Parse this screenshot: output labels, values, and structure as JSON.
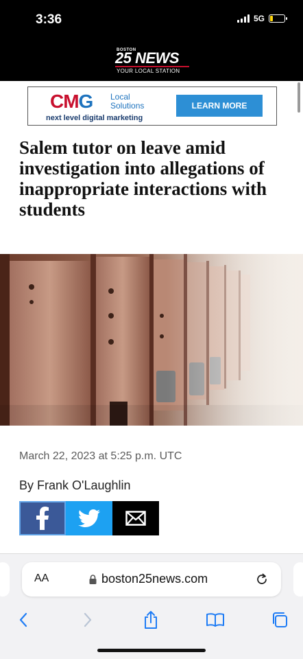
{
  "status_bar": {
    "time": "3:36",
    "network": "5G",
    "battery_level": 0.2
  },
  "site_header": {
    "logo_small": "BOSTON",
    "logo_main": "25 NEWS",
    "logo_tagline": "YOUR LOCAL STATION"
  },
  "ad": {
    "brand": "CMG",
    "brand_sub_line1": "Local",
    "brand_sub_line2": "Solutions",
    "tagline": "next level digital marketing",
    "cta": "LEARN MORE"
  },
  "article": {
    "headline": "Salem tutor on leave amid investigation into allegations of inappropriate interactions with students",
    "date": "March 22, 2023 at 5:25 p.m. UTC",
    "byline": "By Frank O'Laughlin",
    "share": {
      "facebook_icon": "facebook-icon",
      "twitter_icon": "twitter-icon",
      "email_icon": "email-icon"
    }
  },
  "browser": {
    "text_size_label": "AA",
    "url": "boston25news.com",
    "toolbar_icons": [
      "back-icon",
      "forward-icon",
      "share-icon",
      "bookmarks-icon",
      "tabs-icon"
    ]
  },
  "colors": {
    "brand_red": "#c8102e",
    "facebook": "#3b5998",
    "twitter": "#1da1f2",
    "ad_button": "#2d8fd5"
  }
}
